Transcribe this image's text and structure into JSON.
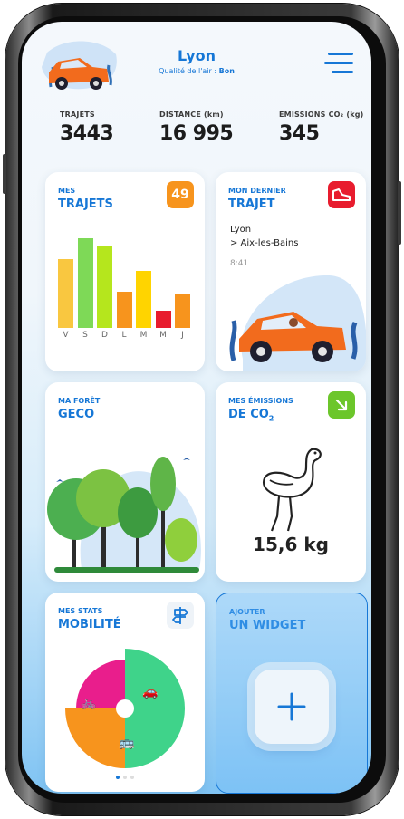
{
  "header": {
    "city": "Lyon",
    "air_label": "Qualité de l'air : ",
    "air_value": "Bon"
  },
  "stats": [
    {
      "label": "TRAJETS",
      "value": "3443"
    },
    {
      "label": "DISTANCE (km)",
      "value": "16 995"
    },
    {
      "label": "EMISSIONS CO₂ (kg)",
      "value": "345"
    }
  ],
  "trips_card": {
    "line1": "MES",
    "line2": "TRAJETS",
    "badge": "49",
    "badge_color": "#f7941d",
    "days": [
      "V",
      "S",
      "D",
      "L",
      "M",
      "M",
      "J"
    ],
    "bars": [
      {
        "value": 0.68,
        "color": "#f9c740"
      },
      {
        "value": 0.88,
        "color": "#7ed957"
      },
      {
        "value": 0.8,
        "color": "#b5e61d"
      },
      {
        "value": 0.36,
        "color": "#f7941d"
      },
      {
        "value": 0.56,
        "color": "#ffd400"
      },
      {
        "value": 0.17,
        "color": "#e81c2e"
      },
      {
        "value": 0.33,
        "color": "#f7941d"
      }
    ]
  },
  "last_trip_card": {
    "line1": "MON DERNIER",
    "line2": "TRAJET",
    "from": "Lyon",
    "to": "> Aix-les-Bains",
    "time": "8:41",
    "badge_color": "#e81c2e",
    "badge_icon": "shoe-icon"
  },
  "forest_card": {
    "line1": "MA FORÊT",
    "line2": "GECO"
  },
  "emissions_card": {
    "line1": "MES ÉMISSIONS",
    "line2": "DE CO",
    "line2_sub": "2",
    "value": "15,6 kg",
    "badge_color": "#6cc62b",
    "badge_icon": "arrow-down-right-icon"
  },
  "mobility_card": {
    "line1": "MES STATS",
    "line2": "MOBILITÉ",
    "badge_icon": "signpost-icon",
    "slices": [
      {
        "name": "bike",
        "value": 0.5,
        "color": "#3fd38a"
      },
      {
        "name": "car",
        "value": 0.25,
        "color": "#f7941d"
      },
      {
        "name": "bus",
        "value": 0.25,
        "color": "#e91e8c"
      }
    ]
  },
  "add_widget": {
    "line1": "AJOUTER",
    "line2": "UN WIDGET"
  },
  "colors": {
    "accent": "#1677d6"
  }
}
